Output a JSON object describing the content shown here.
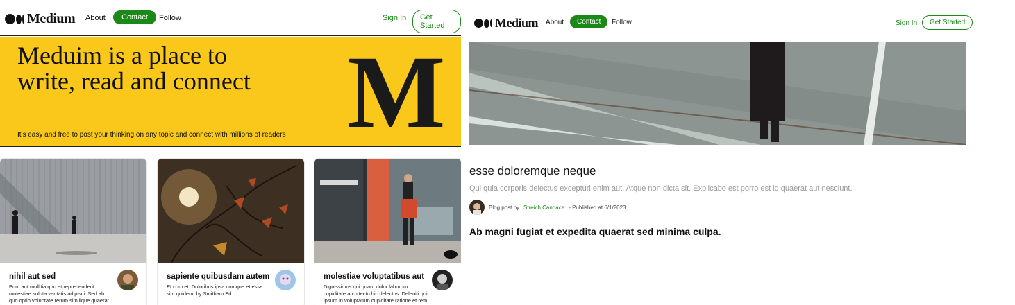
{
  "home": {
    "nav": {
      "logo": "Medium",
      "about": "About",
      "contact": "Contact",
      "follow": "Follow",
      "sign_in": "Sign In",
      "get_started": "Get Started"
    },
    "hero": {
      "headline_underlined": "Meduim",
      "headline_rest": " is a place to write, read and connect",
      "tagline": "It's easy and free to post your thinking on any topic and connect with millions of readers",
      "big_letter": "M"
    },
    "cards": [
      {
        "title": "nihil aut sed",
        "description": "Eum aut mollitia quo et reprehenderit molestiae soluta veritatis adipisci. Sed ab quo optio voluptate rerum similique quaerat."
      },
      {
        "title": "sapiente quibusdam autem",
        "description": "Et cum et. Doloribus ipsa cumque et esse sint quidem. by Smitham Ed"
      },
      {
        "title": "molestiae voluptatibus aut",
        "description": "Dignissimos qui quam dolor laborum cupiditate architecto hic delectus. Deleniti qui ipsum in voluptatum cupiditate ratione et rem"
      }
    ]
  },
  "article": {
    "nav": {
      "logo": "Medium",
      "about": "About",
      "contact": "Contact",
      "follow": "Follow",
      "sign_in": "Sign In",
      "get_started": "Get Started"
    },
    "title": "esse doloremque neque",
    "subtitle": "Qui quia corporis delectus excepturi enim aut. Atque non dicta sit. Explicabo est porro est id quaerat aut nesciunt.",
    "meta": {
      "prefix": "Blog post by",
      "author": "Streich Candace",
      "published": "- Published at 6/1/2023"
    },
    "body": "Ab magni fugiat et expedita quaerat sed minima culpa."
  },
  "colors": {
    "brand_green": "#1a8917",
    "hero_yellow": "#fac81a"
  }
}
